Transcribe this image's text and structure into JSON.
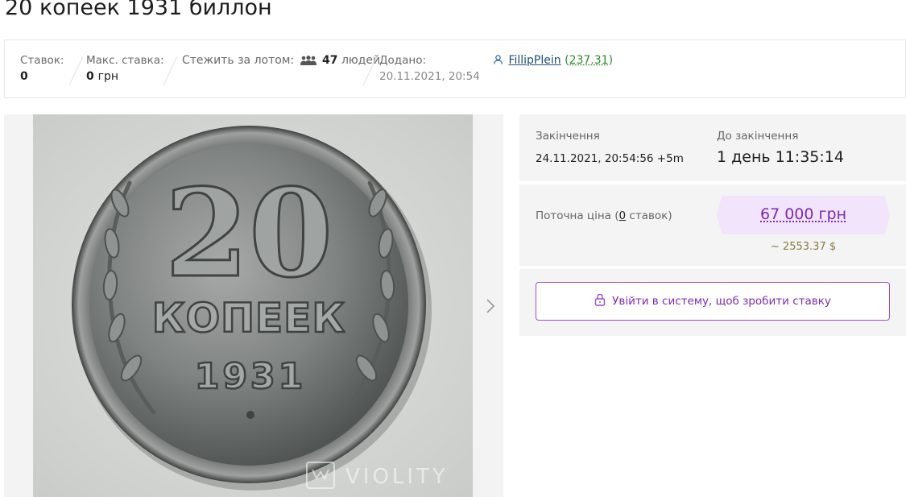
{
  "lot": {
    "title": "20 копеек 1931 биллон"
  },
  "infobar": {
    "bids_label": "Ставок:",
    "bids_value": "0",
    "max_bid_label": "Макс. ставка:",
    "max_bid_value": "0",
    "max_bid_unit": "грн",
    "watch_label": "Стежить за лотом:",
    "watch_count": "47",
    "watch_suffix": "людей",
    "added_label": "Додано:",
    "added_date": "20.11.2021, 20:54",
    "seller_name": "FillipPlein",
    "seller_rating": "237.31",
    "people_icon": "people-icon",
    "user_icon": "user-icon"
  },
  "image": {
    "watermark": "VIOLITY",
    "coin_value": "20",
    "coin_word": "КОПЕЕК",
    "coin_year": "1931"
  },
  "auction": {
    "end_label": "Закінчення",
    "end_value": "24.11.2021, 20:54:56 +5m",
    "remaining_label": "До закінчення",
    "remaining_value": "1 день 11:35:14",
    "current_price_label_before": "Поточна ціна (",
    "bids_count": "0",
    "current_price_label_after": " ставок)",
    "price": "67 000 грн",
    "price_usd": "~ 2553.37 $",
    "login_button": "Увійти в систему, щоб зробити ставку",
    "lock_icon": "lock-icon"
  },
  "colors": {
    "accent": "#7d2bb5",
    "price_bg": "#f1e4fb",
    "panel_bg": "#f4f4f4",
    "rating": "#2e8b2e"
  }
}
